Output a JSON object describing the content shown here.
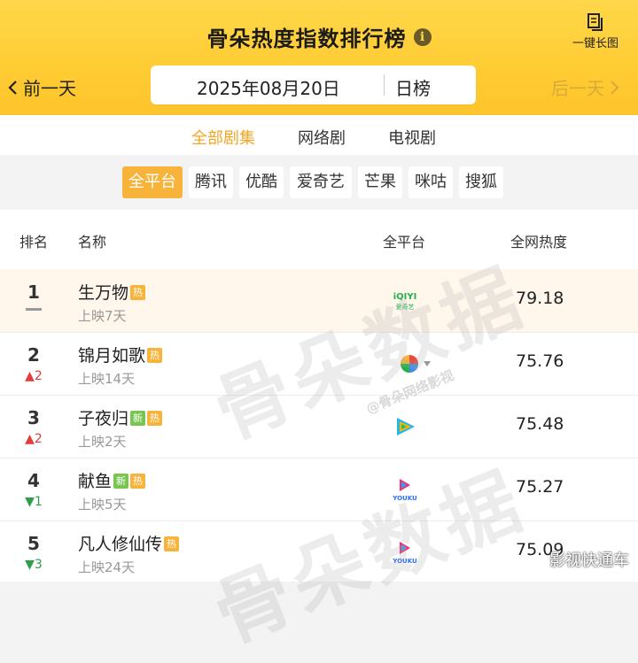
{
  "header": {
    "title": "骨朵热度指数排行榜",
    "info_icon": "i",
    "long_image_label": "一键长图",
    "prev_label": "前一天",
    "next_label": "后一天",
    "date": "2025年08月20日",
    "range": "日榜"
  },
  "category_tabs": [
    {
      "label": "全部剧集",
      "active": true
    },
    {
      "label": "网络剧",
      "active": false
    },
    {
      "label": "电视剧",
      "active": false
    }
  ],
  "platforms": [
    {
      "label": "全平台",
      "active": true
    },
    {
      "label": "腾讯",
      "active": false
    },
    {
      "label": "优酷",
      "active": false
    },
    {
      "label": "爱奇艺",
      "active": false
    },
    {
      "label": "芒果",
      "active": false
    },
    {
      "label": "咪咕",
      "active": false
    },
    {
      "label": "搜狐",
      "active": false
    }
  ],
  "table": {
    "headers": {
      "rank": "排名",
      "name": "名称",
      "platform": "全平台",
      "heat": "全网热度"
    },
    "rows": [
      {
        "rank": "1",
        "change": "",
        "trend": "same",
        "name": "生万物",
        "tags": [
          "热"
        ],
        "days": "上映7天",
        "platform": "iqiyi-logo",
        "heat": "79.18"
      },
      {
        "rank": "2",
        "change": "2",
        "trend": "up",
        "name": "锦月如歌",
        "tags": [
          "热"
        ],
        "days": "上映14天",
        "platform": "multi-platform-icon",
        "heat": "75.76"
      },
      {
        "rank": "3",
        "change": "2",
        "trend": "up",
        "name": "子夜归",
        "tags": [
          "新",
          "热"
        ],
        "days": "上映2天",
        "platform": "tencent-video-logo",
        "heat": "75.48"
      },
      {
        "rank": "4",
        "change": "1",
        "trend": "down",
        "name": "献鱼",
        "tags": [
          "新",
          "热"
        ],
        "days": "上映5天",
        "platform": "youku-logo",
        "heat": "75.27"
      },
      {
        "rank": "5",
        "change": "3",
        "trend": "down",
        "name": "凡人修仙传",
        "tags": [
          "热"
        ],
        "days": "上映24天",
        "platform": "youku-logo",
        "heat": "75.09"
      }
    ]
  },
  "logo_text": {
    "iqiyi": "iQIYI",
    "iqiyi_sub": "爱奇艺",
    "youku": "YOUKU"
  },
  "watermark": {
    "main": "骨朵数据",
    "sub": "@骨朵网络影视",
    "corner": "影视快通车"
  },
  "colors": {
    "accent": "#f5a623",
    "header": "#ffcc33",
    "up": "#e43b3b",
    "down": "#2e9e4a",
    "tag_hot": "#f7b33a",
    "tag_new": "#79c552"
  }
}
